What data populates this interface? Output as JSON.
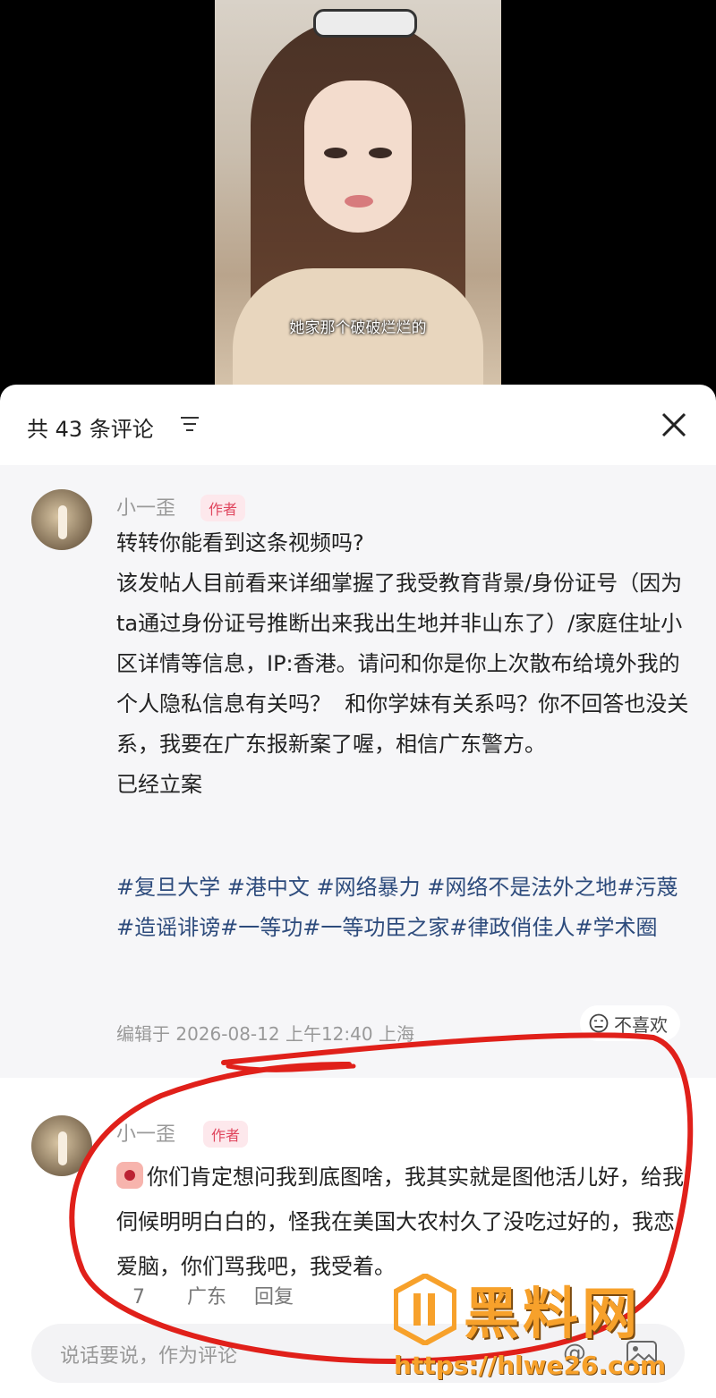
{
  "video": {
    "subtitle": "她家那个破破烂烂的"
  },
  "comments_header": {
    "title": "共 43 条评论",
    "filter_icon": "filter-icon",
    "close_icon": "close-icon"
  },
  "comments": [
    {
      "username": "小一歪",
      "badge": "作者",
      "text": "转转你能看到这条视频吗?\n该发帖人目前看来详细掌握了我受教育背景/身份证号（因为ta通过身份证号推断出来我出生地并非山东了）/家庭住址小区详情等信息，IP:香港。请问和你是你上次散布给境外我的个人隐私信息有关吗？  和你学妹有关系吗？你不回答也没关系，我要在广东报新案了喔，相信广东警方。\n已经立案",
      "hashtags": "#复旦大学 #港中文 #网络暴力 #网络不是法外之地#污蔑#造谣诽谤#一等功#一等功臣之家#律政俏佳人#学术圈",
      "meta": "编辑于  2026-08-12 上午12:40 上海",
      "dislike": "不喜欢"
    },
    {
      "username": "小一歪",
      "badge": "作者",
      "text": "你们肯定想问我到底图啥，我其实就是图他活儿好，给我伺候明明白白的，怪我在美国大农村久了没吃过好的，我恋爱脑，你们骂我吧，我受着。",
      "time": "7",
      "location": "广东",
      "reply": "回复"
    }
  ],
  "input": {
    "placeholder": "说话要说，作为评论"
  },
  "watermark": {
    "title": "黑料网",
    "url": "https://hlwe26.com"
  },
  "colors": {
    "author_badge": "#e0465e",
    "hashtag": "#2d4b7c",
    "annotation": "#e0201a",
    "watermark": "#f7a12b"
  }
}
